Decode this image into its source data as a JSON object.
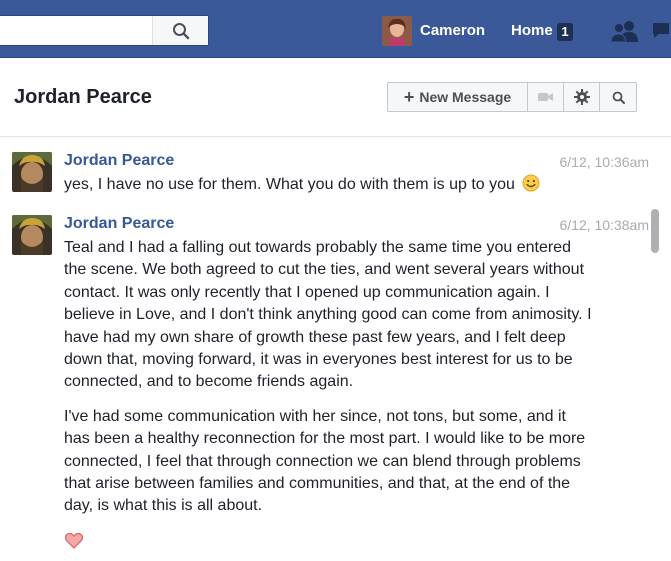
{
  "topbar": {
    "search_placeholder": "",
    "user_name": "Cameron",
    "home_label": "Home",
    "home_count": "1"
  },
  "header": {
    "title": "Jordan Pearce",
    "new_message_label": "New Message"
  },
  "messages": [
    {
      "sender": "Jordan Pearce",
      "time": "6/12, 10:36am",
      "text": "yes, I have no use for them. What you do with them is up to you",
      "emoji": "smiley-icon"
    },
    {
      "sender": "Jordan Pearce",
      "time": "6/12, 10:38am",
      "paragraphs": [
        "Teal and I had a falling out towards probably the same time you entered the scene. We both agreed to cut the ties, and went several years without contact. It was only recently that I opened up communication again. I believe in Love, and I don't think anything good can come from animosity. I have had my own share of growth these past few years, and I felt deep down that, moving forward, it was in everyones best interest for us to be connected, and to become friends again.",
        "I've had some communication with her since, not tons, but some, and it has been a healthy reconnection for the most part. I would like to be more connected, I feel that through connection we can blend through problems that arise between families and communities, and that, at the end of the day, is what this is all about."
      ],
      "reaction": "heart-icon"
    }
  ],
  "colors": {
    "brand_blue": "#3b5998",
    "link_blue": "#365899",
    "timestamp_gray": "#a7abb1"
  }
}
